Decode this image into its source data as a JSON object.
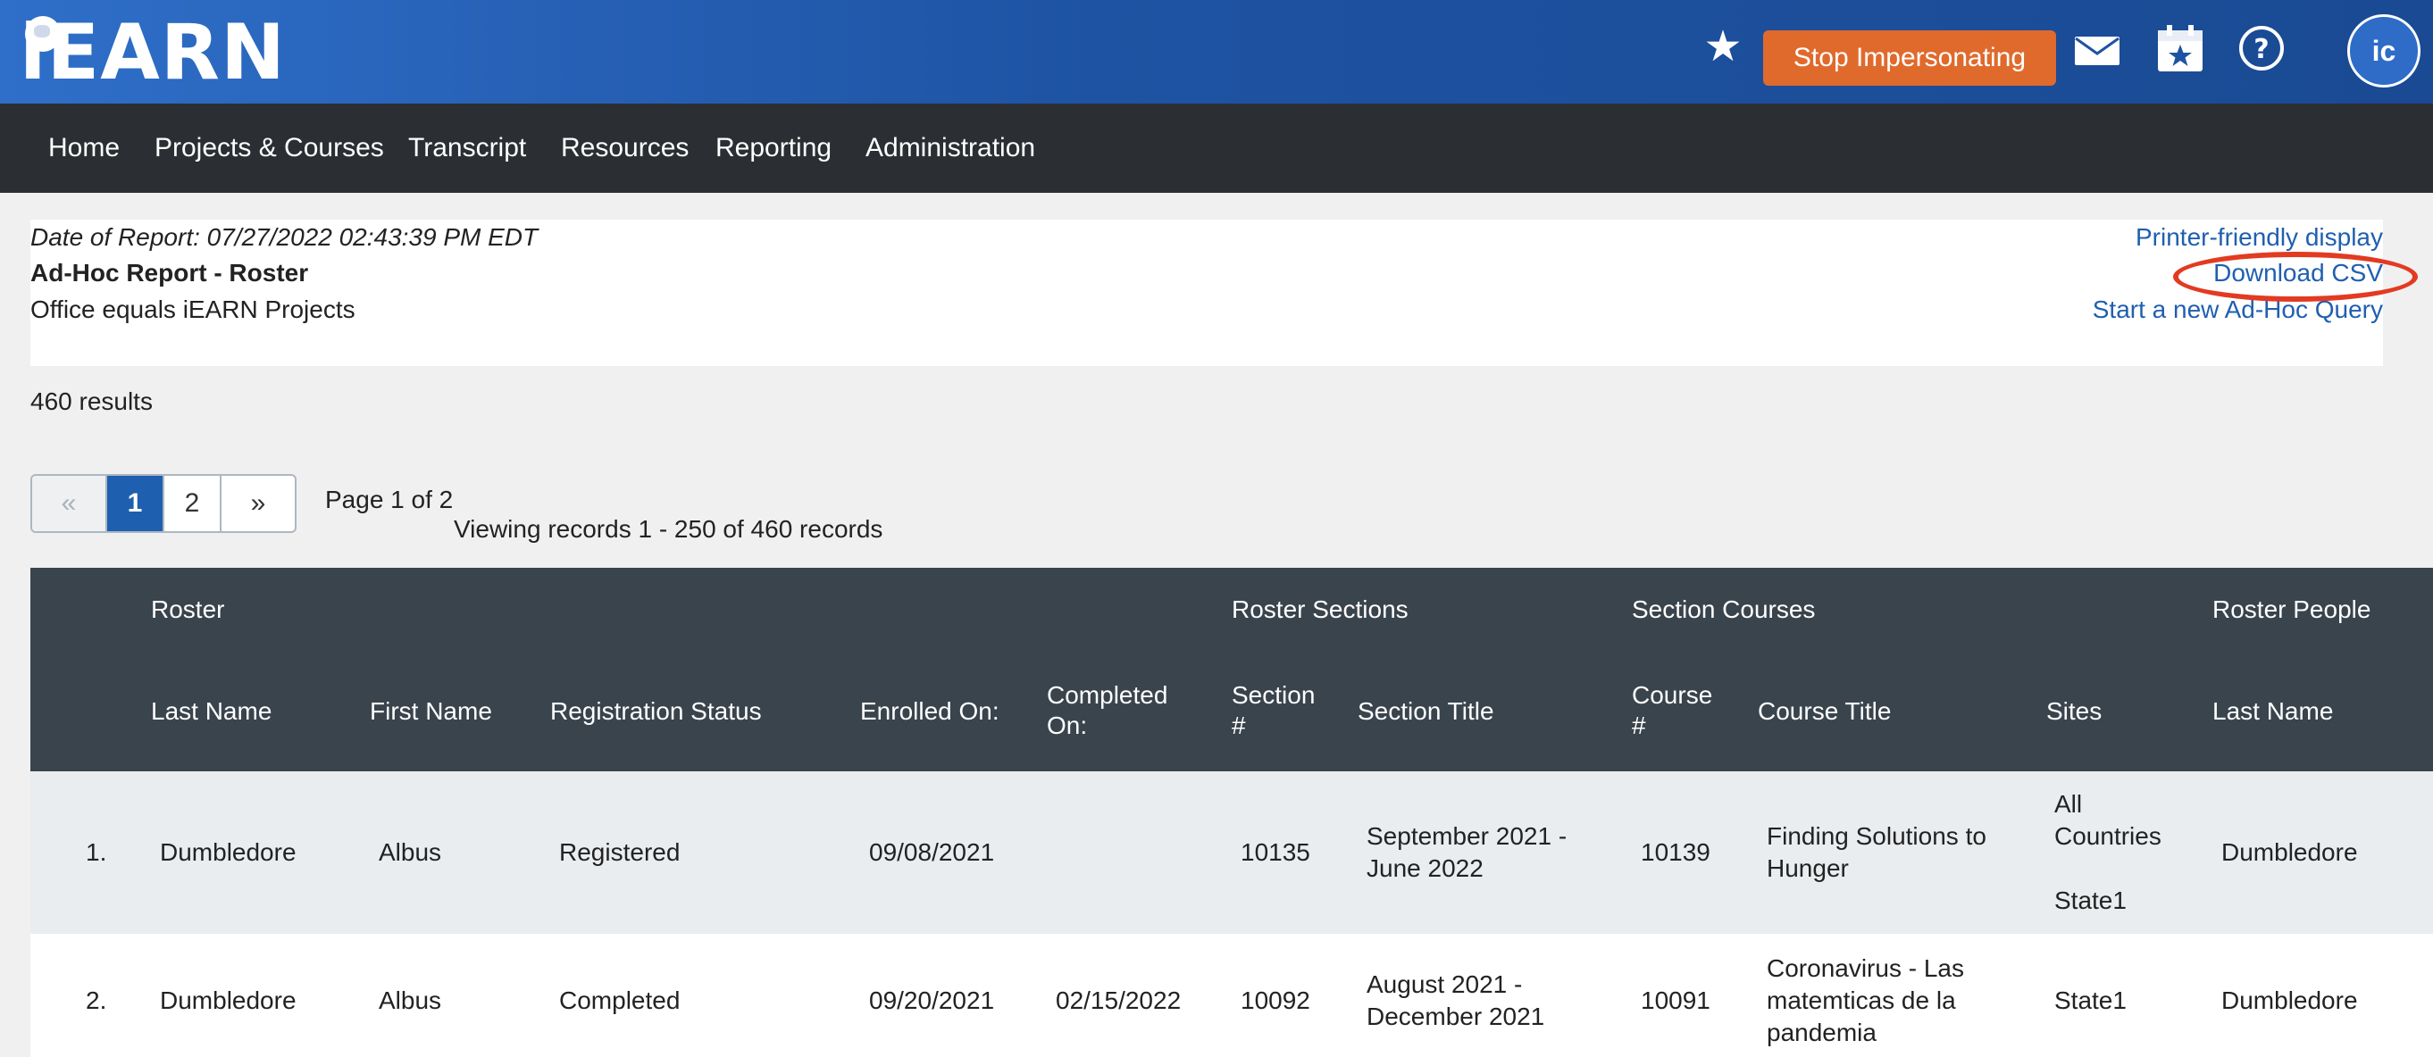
{
  "header": {
    "logo_text": "iEARN",
    "stop_impersonating_label": "Stop Impersonating",
    "avatar_initials": "ic",
    "icons": [
      "star-icon",
      "mail-icon",
      "calendar-star-icon",
      "help-icon"
    ],
    "colors": {
      "header_bg": "#1e53a3",
      "stop_button": "#e06a2c",
      "nav_bg": "#2b2f33",
      "link": "#1f5fb0"
    }
  },
  "nav": {
    "items": [
      "Home",
      "Projects & Courses",
      "Transcript",
      "Resources",
      "Reporting",
      "Administration"
    ]
  },
  "report": {
    "date_line": "Date of Report: 07/27/2022 02:43:39 PM EDT",
    "title": "Ad-Hoc Report - Roster",
    "filter": "Office equals iEARN Projects",
    "links": {
      "printer": "Printer-friendly display",
      "csv": "Download CSV",
      "new_query": "Start a new Ad-Hoc Query"
    },
    "results": "460 results"
  },
  "pagination": {
    "prev": "«",
    "pages": [
      "1",
      "2"
    ],
    "next": "»",
    "page_of": "Page 1 of 2",
    "viewing": "Viewing records 1 - 250 of 460 records"
  },
  "table": {
    "groups": {
      "roster": "Roster",
      "roster_sections": "Roster Sections",
      "section_courses": "Section Courses",
      "roster_people": "Roster People"
    },
    "columns": {
      "last_name": "Last Name",
      "first_name": "First Name",
      "registration_status": "Registration Status",
      "enrolled_on": "Enrolled On:",
      "completed_on_1": "Completed",
      "completed_on_2": "On:",
      "section_num_1": "Section",
      "section_num_2": "#",
      "section_title": "Section Title",
      "course_num_1": "Course",
      "course_num_2": "#",
      "course_title": "Course Title",
      "sites": "Sites",
      "people_last_name": "Last Name"
    },
    "rows": [
      {
        "index": "1.",
        "last_name": "Dumbledore",
        "first_name": "Albus",
        "status": "Registered",
        "enrolled": "09/08/2021",
        "completed": "",
        "section_num": "10135",
        "section_title_1": "September 2021 -",
        "section_title_2": "June 2022",
        "course_num": "10139",
        "course_title_1": "Finding Solutions to",
        "course_title_2": "Hunger",
        "course_title_3": "",
        "sites_1": "All",
        "sites_2": "Countries",
        "sites_3": "State1",
        "people_last_name": "Dumbledore"
      },
      {
        "index": "2.",
        "last_name": "Dumbledore",
        "first_name": "Albus",
        "status": "Completed",
        "enrolled": "09/20/2021",
        "completed": "02/15/2022",
        "section_num": "10092",
        "section_title_1": "August 2021 -",
        "section_title_2": "December 2021",
        "course_num": "10091",
        "course_title_1": "Coronavirus - Las",
        "course_title_2": "matemticas de la",
        "course_title_3": "pandemia",
        "sites_1": "State1",
        "sites_2": "",
        "sites_3": "",
        "people_last_name": "Dumbledore"
      }
    ]
  }
}
